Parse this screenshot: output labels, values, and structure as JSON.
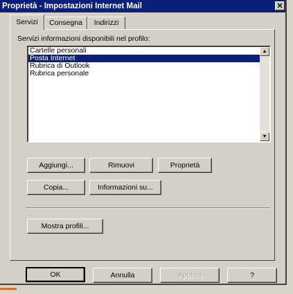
{
  "window": {
    "title": "Proprietà - Impostazioni Internet Mail",
    "close_glyph": "✕"
  },
  "tabs": [
    {
      "label": "Servizi"
    },
    {
      "label": "Consegna"
    },
    {
      "label": "Indirizzi"
    }
  ],
  "services": {
    "list_label": "Servizi informazioni disponibili nel profilo:",
    "items": [
      {
        "label": "Cartelle personali",
        "selected": false
      },
      {
        "label": "Posta Internet",
        "selected": true
      },
      {
        "label": "Rubrica di Outlook",
        "selected": false
      },
      {
        "label": "Rubrica personale",
        "selected": false
      }
    ]
  },
  "buttons": {
    "aggiungi": "Aggiungi...",
    "rimuovi": "Rimuovi",
    "proprieta": "Proprietà",
    "copia": "Copia...",
    "informazioni": "Informazioni su...",
    "mostra_profili": "Mostra profili..."
  },
  "footer": {
    "ok": "OK",
    "annulla": "Annulla",
    "applica": "Applica",
    "help": "?"
  },
  "colors": {
    "titlebar": "#0a1f7a",
    "selection": "#0a1f7a",
    "face": "#d4d0c8"
  }
}
